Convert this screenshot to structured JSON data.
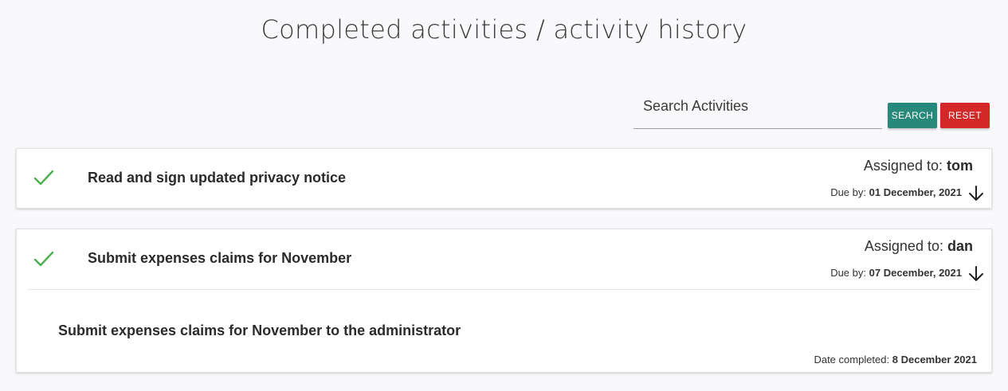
{
  "page": {
    "title": "Completed activities / activity history"
  },
  "search": {
    "placeholder": "Search Activities",
    "value": "",
    "search_label": "SEARCH",
    "reset_label": "RESET"
  },
  "colors": {
    "search_button": "#26897a",
    "reset_button": "#d32828",
    "check": "#4caf50"
  },
  "activities": [
    {
      "title": "Read and sign updated privacy notice",
      "status_icon": "check-icon",
      "assigned_label": "Assigned to:",
      "assignee": "tom",
      "due_label": "Due by:",
      "due_date": "01 December, 2021",
      "expand_icon": "arrow-down-icon",
      "expanded": false
    },
    {
      "title": "Submit expenses claims for November",
      "status_icon": "check-icon",
      "assigned_label": "Assigned to:",
      "assignee": "dan",
      "due_label": "Due by:",
      "due_date": "07 December, 2021",
      "expand_icon": "arrow-down-icon",
      "expanded": true,
      "description": "Submit expenses claims for November to the administrator",
      "completed_label": "Date completed:",
      "completed_date": "8 December 2021"
    }
  ]
}
